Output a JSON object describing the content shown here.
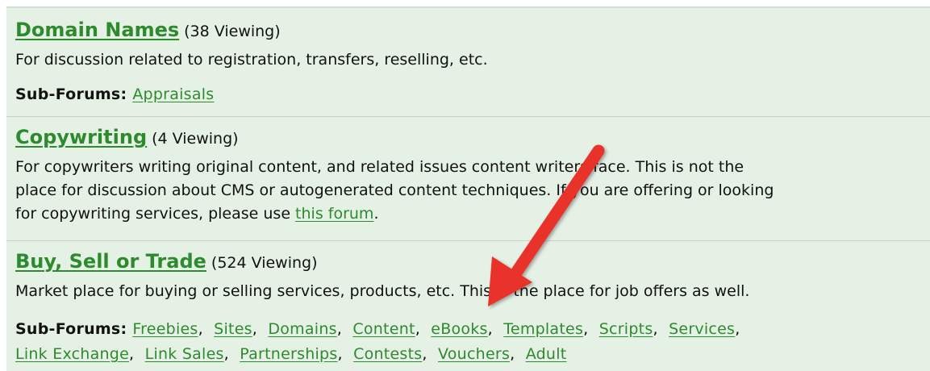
{
  "forums": [
    {
      "title": "Domain Names",
      "viewing": "(38 Viewing)",
      "description": "For discussion related to registration, transfers, reselling, etc.",
      "subforums_label": "Sub-Forums:",
      "subforums": [
        "Appraisals"
      ]
    },
    {
      "title": "Copywriting",
      "viewing": "(4 Viewing)",
      "description_lines": [
        "For copywriters writing original content, and related issues content writers face. This is not the",
        "place for discussion about CMS or autogenerated content techniques. If you are offering or looking",
        "for copywriting services, please use "
      ],
      "description_link": "this forum",
      "description_end": "."
    },
    {
      "title": "Buy, Sell or Trade",
      "viewing": "(524 Viewing)",
      "description": "Market place for buying or selling services, products, etc. This is the place for job offers as well.",
      "subforums_label": "Sub-Forums:",
      "subforums": [
        "Freebies",
        "Sites",
        "Domains",
        "Content",
        "eBooks",
        "Templates",
        "Scripts",
        "Services",
        "Link Exchange",
        "Link Sales",
        "Partnerships",
        "Contests",
        "Vouchers",
        "Adult"
      ]
    }
  ],
  "annotation": {
    "arrow_color": "#e8332a",
    "icon": "arrow-annotation-icon"
  },
  "colors": {
    "background": "#e6f1e6",
    "link": "#2d8a2d",
    "divider": "#c9d1c9"
  }
}
